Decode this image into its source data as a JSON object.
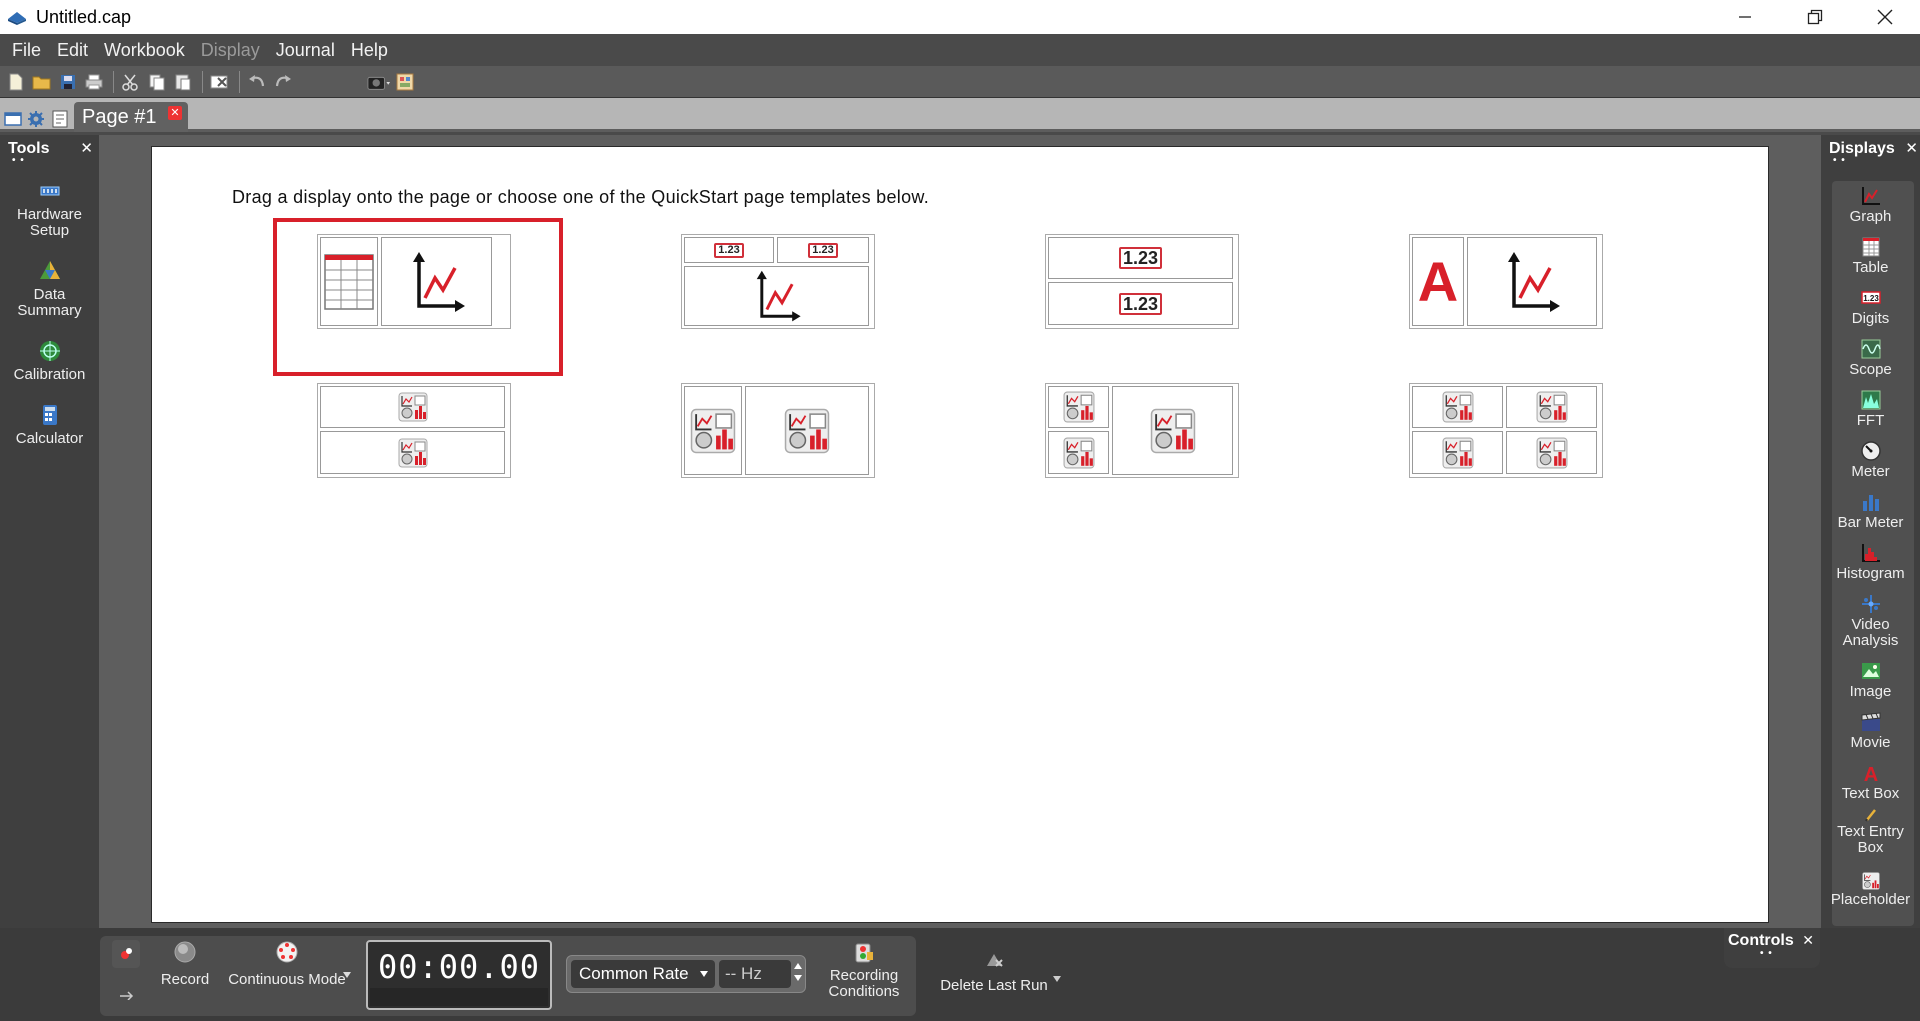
{
  "window": {
    "title": "Untitled.cap"
  },
  "menu": [
    "File",
    "Edit",
    "Workbook",
    "Display",
    "Journal",
    "Help"
  ],
  "page_tab": {
    "label": "Page #1"
  },
  "instruction": "Drag a display onto the page or choose one of the QuickStart page templates below.",
  "tools": {
    "title": "Tools",
    "items": [
      {
        "label_line1": "Hardware",
        "label_line2": "Setup",
        "icon": "hardware-setup-icon"
      },
      {
        "label_line1": "Data",
        "label_line2": "Summary",
        "icon": "data-summary-icon"
      },
      {
        "label_line1": "Calibration",
        "label_line2": "",
        "icon": "calibration-icon"
      },
      {
        "label_line1": "Calculator",
        "label_line2": "",
        "icon": "calculator-icon"
      }
    ]
  },
  "displays": {
    "title": "Displays",
    "items": [
      {
        "label_line1": "Graph",
        "label_line2": "",
        "icon": "graph-icon"
      },
      {
        "label_line1": "Table",
        "label_line2": "",
        "icon": "table-icon"
      },
      {
        "label_line1": "Digits",
        "label_line2": "",
        "icon": "digits-icon"
      },
      {
        "label_line1": "Scope",
        "label_line2": "",
        "icon": "scope-icon"
      },
      {
        "label_line1": "FFT",
        "label_line2": "",
        "icon": "fft-icon"
      },
      {
        "label_line1": "Meter",
        "label_line2": "",
        "icon": "meter-icon"
      },
      {
        "label_line1": "Bar Meter",
        "label_line2": "",
        "icon": "bar-meter-icon"
      },
      {
        "label_line1": "Histogram",
        "label_line2": "",
        "icon": "histogram-icon"
      },
      {
        "label_line1": "Video",
        "label_line2": "Analysis",
        "icon": "video-analysis-icon"
      },
      {
        "label_line1": "Image",
        "label_line2": "",
        "icon": "image-icon"
      },
      {
        "label_line1": "Movie",
        "label_line2": "",
        "icon": "movie-icon"
      },
      {
        "label_line1": "Text Box",
        "label_line2": "",
        "icon": "text-box-icon"
      },
      {
        "label_line1": "Text Entry",
        "label_line2": "Box",
        "icon": "text-entry-box-icon"
      },
      {
        "label_line1": "Placeholder",
        "label_line2": "",
        "icon": "placeholder-icon"
      }
    ]
  },
  "templates": {
    "digits_text": "1.23",
    "text_glyph": "A"
  },
  "controls": {
    "title": "Controls",
    "record_label": "Record",
    "mode_label": "Continuous Mode",
    "timer": "00:00.00",
    "rate_select": "Common Rate",
    "hz_value": "-- Hz",
    "recording_conditions_line1": "Recording",
    "recording_conditions_line2": "Conditions",
    "delete_last_run": "Delete Last Run"
  },
  "colors": {
    "accent_red": "#d8202a",
    "panel_bg": "#3f3f3f",
    "page_bg": "#ffffff"
  }
}
